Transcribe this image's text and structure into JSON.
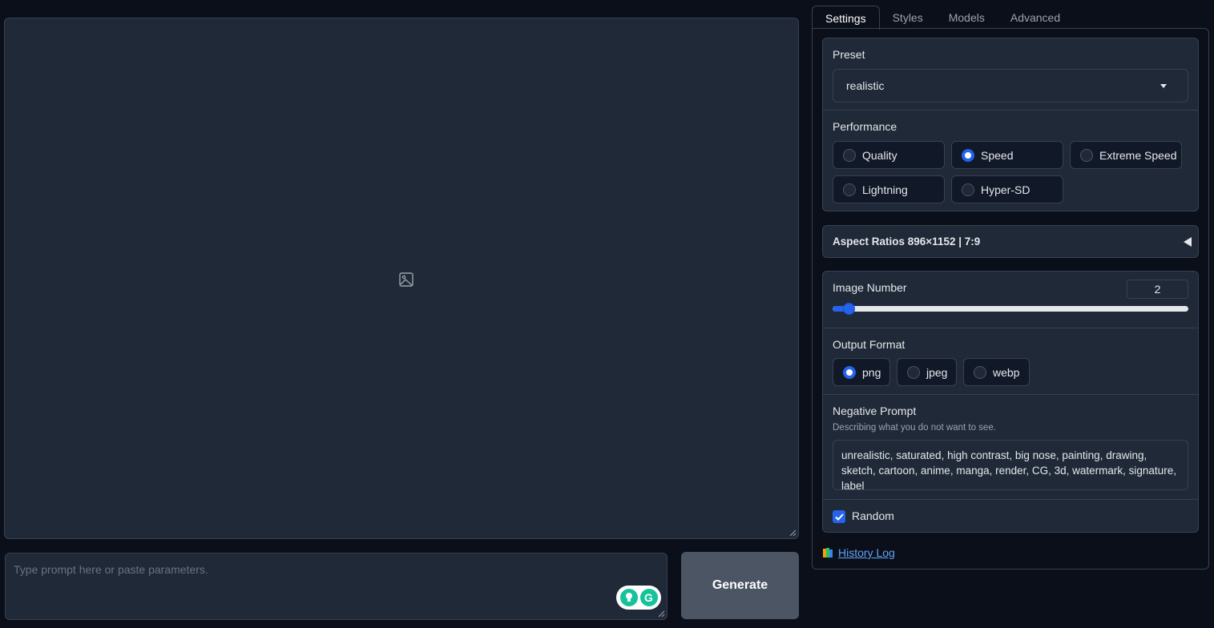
{
  "prompt": {
    "placeholder": "Type prompt here or paste parameters."
  },
  "generate": {
    "label": "Generate"
  },
  "tabs": [
    {
      "label": "Settings"
    },
    {
      "label": "Styles"
    },
    {
      "label": "Models"
    },
    {
      "label": "Advanced"
    }
  ],
  "preset": {
    "label": "Preset",
    "value": "realistic"
  },
  "performance": {
    "label": "Performance",
    "options": [
      "Quality",
      "Speed",
      "Extreme Speed",
      "Lightning",
      "Hyper-SD"
    ],
    "selected": "Speed"
  },
  "aspect_ratios": {
    "label": "Aspect Ratios 896×1152 | 7:9"
  },
  "image_number": {
    "label": "Image Number",
    "value": "2",
    "fraction": 0.03
  },
  "output_format": {
    "label": "Output Format",
    "options": [
      "png",
      "jpeg",
      "webp"
    ],
    "selected": "png"
  },
  "negative_prompt": {
    "label": "Negative Prompt",
    "info": "Describing what you do not want to see.",
    "value": "unrealistic, saturated, high contrast, big nose, painting, drawing, sketch, cartoon, anime, manga, render, CG, 3d, watermark, signature, label"
  },
  "random": {
    "label": "Random",
    "checked": true
  },
  "history": {
    "label": "History Log"
  },
  "colors": {
    "accent": "#2563eb",
    "background": "#0b0f19",
    "panel": "#1f2937",
    "link": "#60a5fa"
  }
}
